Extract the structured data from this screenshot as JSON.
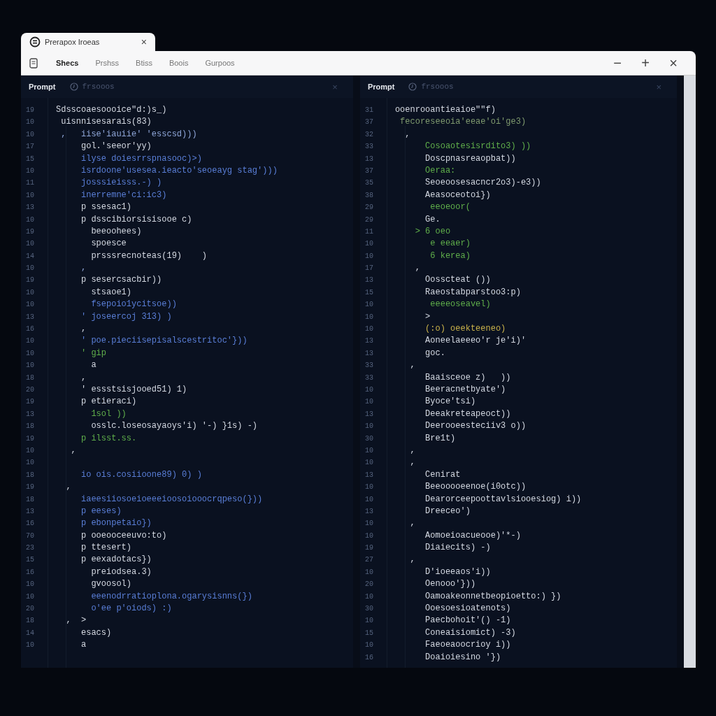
{
  "browser_tab": {
    "title": "Prerapox Iroeas",
    "close": "×"
  },
  "toolbar": {
    "items": [
      {
        "label": "Shecs",
        "selected": true
      },
      {
        "label": "Prshss",
        "selected": false
      },
      {
        "label": "Btiss",
        "selected": false
      },
      {
        "label": "Boois",
        "selected": false
      },
      {
        "label": "Gurpoos",
        "selected": false
      }
    ],
    "window_controls": [
      "−",
      "+",
      "×"
    ]
  },
  "panes": [
    {
      "title": "Prompt",
      "subtitle": "frsooos",
      "close": "×",
      "lines": [
        {
          "number": "19",
          "text": "Sdsscoaesoooice\"d:)s_)",
          "kind": "text"
        },
        {
          "number": "10",
          "text": " uisnnisesarais(83)",
          "kind": "text"
        },
        {
          "number": "10",
          "text": " ,   iise'iauiie' 'esscsd)))",
          "kind": "param"
        },
        {
          "number": "17",
          "text": "     gol.'seeor'yy)",
          "kind": "text"
        },
        {
          "number": "15",
          "text": "     ilyse doiesrrspnasooc)>)",
          "kind": "call"
        },
        {
          "number": "10",
          "text": "     isrdoone'usesea.ieacto'seoeayg stag')))",
          "kind": "call"
        },
        {
          "number": "11",
          "text": "     josssieisss.-) )",
          "kind": "call"
        },
        {
          "number": "10",
          "text": "     inerremne'ci:ic3)",
          "kind": "call"
        },
        {
          "number": "13",
          "text": "     p ssesac1)",
          "kind": "text"
        },
        {
          "number": "10",
          "text": "     p dsscibiorsisisooe c)",
          "kind": "text"
        },
        {
          "number": "19",
          "text": "       beeoohees)",
          "kind": "text"
        },
        {
          "number": "10",
          "text": "       spoesce",
          "kind": "text"
        },
        {
          "number": "14",
          "text": "       prsssrecnoteas(19)    )",
          "kind": "text"
        },
        {
          "number": "10",
          "text": "     ,",
          "kind": "param"
        },
        {
          "number": "19",
          "text": "     p sesercsacbir))",
          "kind": "text"
        },
        {
          "number": "10",
          "text": "       stsaoe1)",
          "kind": "text"
        },
        {
          "number": "10",
          "text": "       fsepoio1ycitsoe))",
          "kind": "call"
        },
        {
          "number": "13",
          "text": "     ' joseercoj 313) )",
          "kind": "call"
        },
        {
          "number": "16",
          "text": "     ,",
          "kind": "text"
        },
        {
          "number": "10",
          "text": "     ' poe.pieciisepisalscestritoc'}))",
          "kind": "call"
        },
        {
          "number": "10",
          "text": "     ' gip",
          "kind": "string"
        },
        {
          "number": "10",
          "text": "       a",
          "kind": "text"
        },
        {
          "number": "18",
          "text": "     ,",
          "kind": "text"
        },
        {
          "number": "20",
          "text": "     ' essstsisjooed51) 1)",
          "kind": "text"
        },
        {
          "number": "19",
          "text": "     p etieraci)",
          "kind": "text"
        },
        {
          "number": "13",
          "text": "       1sol ))",
          "kind": "string"
        },
        {
          "number": "18",
          "text": "       osslc.loseosayaoys'i) '-) }1s) -)",
          "kind": "text"
        },
        {
          "number": "19",
          "text": "     p ilsst.ss.",
          "kind": "string"
        },
        {
          "number": "10",
          "text": "   ,",
          "kind": "text"
        },
        {
          "number": "10"
        },
        {
          "number": "18",
          "text": "     io ois.cosiioone89) 0) )",
          "kind": "call"
        },
        {
          "number": "19",
          "text": "  ,",
          "kind": "text"
        },
        {
          "number": "18",
          "text": "     iaeesiiosoeioeeeioosoiooocrqpeso(}))",
          "kind": "call"
        },
        {
          "number": "13",
          "text": "     p eeses)",
          "kind": "call"
        },
        {
          "number": "16",
          "text": "     p ebonpetaio})",
          "kind": "call"
        },
        {
          "number": "70",
          "text": "     p ooeooceeuvo:to)",
          "kind": "text"
        },
        {
          "number": "23",
          "text": "     p ttesert)",
          "kind": "text"
        },
        {
          "number": "15",
          "text": "     p eexadotacs})",
          "kind": "text"
        },
        {
          "number": "16",
          "text": "       preiodsea.3)",
          "kind": "text"
        },
        {
          "number": "10",
          "text": "       gvoosol)",
          "kind": "text"
        },
        {
          "number": "10",
          "text": "       eeenodrratioplona.ogarysisnns(})",
          "kind": "call"
        },
        {
          "number": "20",
          "text": "       o'ee p'oiods) :)",
          "kind": "call"
        },
        {
          "number": "18",
          "text": "  ,  >",
          "kind": "text"
        },
        {
          "number": "14",
          "text": "     esacs)",
          "kind": "text"
        },
        {
          "number": "10",
          "text": "     a",
          "kind": "text"
        }
      ]
    },
    {
      "title": "Prompt",
      "subtitle": "frsooos",
      "close": "×",
      "lines": [
        {
          "number": "31",
          "text": "ooenrooantieaioe\"\"f)",
          "kind": "text"
        },
        {
          "number": "37",
          "text": " fecoreseeoia'eeae'oi'ge3)",
          "kind": "comment"
        },
        {
          "number": "32",
          "text": "  ,",
          "kind": "text"
        },
        {
          "number": "33",
          "text": "      Cosoaotesisrdito3) ))",
          "kind": "string"
        },
        {
          "number": "13",
          "text": "      Doscpnasreaopbat))",
          "kind": "text"
        },
        {
          "number": "37",
          "text": "      Oeraa:",
          "kind": "string"
        },
        {
          "number": "35",
          "text": "      Seoeoosesacncr2o3)-e3))",
          "kind": "text"
        },
        {
          "number": "38",
          "text": "      Aeasoceotoi})",
          "kind": "text"
        },
        {
          "number": "29",
          "text": "       eeoeoor(",
          "kind": "string"
        },
        {
          "number": "29",
          "text": "      Ge.",
          "kind": "text"
        },
        {
          "number": "11",
          "text": "    > 6 oeo",
          "kind": "string"
        },
        {
          "number": "10",
          "text": "       e eeaer)",
          "kind": "string"
        },
        {
          "number": "10",
          "text": "       6 kerea)",
          "kind": "string"
        },
        {
          "number": "17",
          "text": "    ,",
          "kind": "text"
        },
        {
          "number": "13",
          "text": "      Oosscteat ())",
          "kind": "text"
        },
        {
          "number": "15",
          "text": "      Raeostabparstoo3:p)",
          "kind": "text"
        },
        {
          "number": "10",
          "text": "       eeeeoseavel)",
          "kind": "string"
        },
        {
          "number": "10",
          "text": "      >",
          "kind": "text"
        },
        {
          "number": "10",
          "text": "      (:o) oeekteeneo)",
          "kind": "literal"
        },
        {
          "number": "13",
          "text": "      Aoneelaeeeo'r je'i)'",
          "kind": "text"
        },
        {
          "number": "13",
          "text": "      goc.",
          "kind": "text"
        },
        {
          "number": "33",
          "text": "   ,",
          "kind": "text"
        },
        {
          "number": "33",
          "text": "      Baaisceoe z)   ))",
          "kind": "text"
        },
        {
          "number": "10",
          "text": "      Beeracnetbyate')",
          "kind": "text"
        },
        {
          "number": "10",
          "text": "      Byoce'tsi)",
          "kind": "text"
        },
        {
          "number": "13",
          "text": "      Deeakreteapeoct))",
          "kind": "text"
        },
        {
          "number": "10",
          "text": "      Deerooeesteciiv3 o))",
          "kind": "text"
        },
        {
          "number": "30",
          "text": "      Bre1t)",
          "kind": "text"
        },
        {
          "number": "10",
          "text": "   ,",
          "kind": "text"
        },
        {
          "number": "10",
          "text": "   ,",
          "kind": "text"
        },
        {
          "number": "13",
          "text": "      Cenirat",
          "kind": "text"
        },
        {
          "number": "10",
          "text": "      Beeooooeenoe(i0otc))",
          "kind": "text"
        },
        {
          "number": "10",
          "text": "      Dearorceepoottavlsiooesiog) i))",
          "kind": "text"
        },
        {
          "number": "13",
          "text": "      Dreeceo')",
          "kind": "text"
        },
        {
          "number": "10",
          "text": "   ,",
          "kind": "text"
        },
        {
          "number": "10",
          "text": "      Aomoeioacueooe)'*-)",
          "kind": "text"
        },
        {
          "number": "19",
          "text": "      Diaiecits) -)",
          "kind": "text"
        },
        {
          "number": "27",
          "text": "   ,",
          "kind": "text"
        },
        {
          "number": "10",
          "text": "      D'ioeeaos'i))",
          "kind": "text"
        },
        {
          "number": "20",
          "text": "      Oenooo'}))",
          "kind": "text"
        },
        {
          "number": "10",
          "text": "      Oamoakeonnetbeopioetto:) })",
          "kind": "text"
        },
        {
          "number": "30",
          "text": "      Ooesoesioatenots)",
          "kind": "text"
        },
        {
          "number": "10",
          "text": "      Paecbohoit'() -1)",
          "kind": "text"
        },
        {
          "number": "15",
          "text": "      Coneaisiomict) -3)",
          "kind": "text"
        },
        {
          "number": "10",
          "text": "      Faeoeaoocrioy i))",
          "kind": "text"
        },
        {
          "number": "16",
          "text": "      Doaioiesino '})",
          "kind": "text"
        }
      ]
    }
  ]
}
